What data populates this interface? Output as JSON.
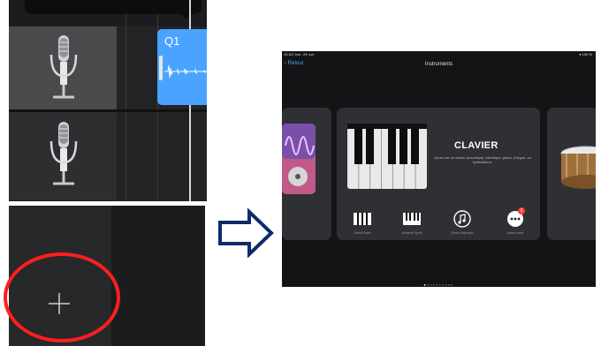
{
  "tracks_panel": {
    "region_label": "Q1"
  },
  "add_track_panel": {
    "plus_symbol": "+"
  },
  "arrow": {
    "color": "#0e2a6b",
    "direction": "right"
  },
  "instruments_screen": {
    "status_left": "10:52  Jeu. 25 oct.",
    "status_right": "▾ 100 %",
    "back_label": "‹ Retour",
    "title": "Instruments",
    "featured": {
      "name": "CLAVIER",
      "description": "Jouez sur un clavier acoustique, électrique, piano, d'orgue, ou synthétiseur."
    },
    "sub_options": [
      {
        "icon": "keyboard-icon",
        "label": "Grand Piano"
      },
      {
        "icon": "alchemy-synth-icon",
        "label": "Alchemy Synth"
      },
      {
        "icon": "smart-keyboard-icon",
        "label": "Smart Keyboard"
      },
      {
        "icon": "more-options-icon",
        "label": "Autres sons",
        "badge": "2"
      }
    ],
    "page_dots": {
      "count": 10,
      "active_index": 0
    }
  },
  "colors": {
    "region_blue": "#4aa3ff",
    "highlight_red": "#ff1e1e",
    "arrow_navy": "#0e2a6b"
  }
}
